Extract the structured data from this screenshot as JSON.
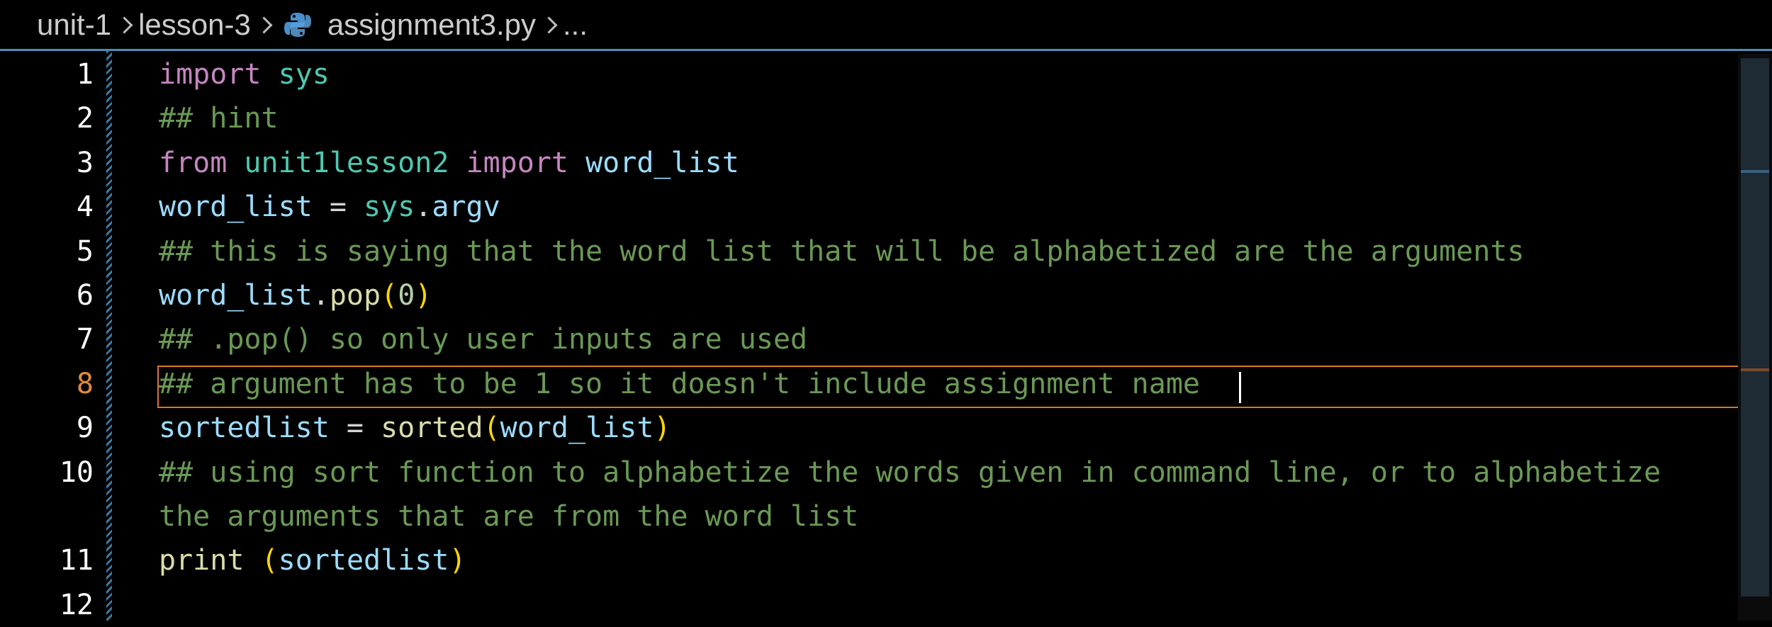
{
  "breadcrumb": {
    "items": [
      "unit-1",
      "lesson-3",
      "assignment3.py",
      "..."
    ]
  },
  "editor": {
    "active_line": 8,
    "lines": [
      {
        "n": "1",
        "tokens": [
          [
            "kw",
            "import"
          ],
          [
            "pun",
            " "
          ],
          [
            "mod",
            "sys"
          ]
        ]
      },
      {
        "n": "2",
        "tokens": [
          [
            "cm",
            "## hint"
          ]
        ]
      },
      {
        "n": "3",
        "tokens": [
          [
            "kw",
            "from"
          ],
          [
            "pun",
            " "
          ],
          [
            "mod",
            "unit1lesson2"
          ],
          [
            "pun",
            " "
          ],
          [
            "kw",
            "import"
          ],
          [
            "pun",
            " "
          ],
          [
            "var",
            "word_list"
          ]
        ]
      },
      {
        "n": "4",
        "tokens": [
          [
            "var",
            "word_list"
          ],
          [
            "pun",
            " = "
          ],
          [
            "mod",
            "sys"
          ],
          [
            "pun",
            "."
          ],
          [
            "var",
            "argv"
          ]
        ]
      },
      {
        "n": "5",
        "tokens": [
          [
            "cm",
            "## this is saying that the word list that will be alphabetized are the arguments"
          ]
        ]
      },
      {
        "n": "6",
        "tokens": [
          [
            "var",
            "word_list"
          ],
          [
            "pun",
            "."
          ],
          [
            "fn",
            "pop"
          ],
          [
            "paren",
            "("
          ],
          [
            "num",
            "0"
          ],
          [
            "paren",
            ")"
          ]
        ]
      },
      {
        "n": "7",
        "tokens": [
          [
            "cm",
            "## .pop() so only user inputs are used"
          ]
        ]
      },
      {
        "n": "8",
        "tokens": [
          [
            "cm",
            "## argument has to be 1 so it doesn't include assignment name"
          ]
        ]
      },
      {
        "n": "9",
        "tokens": [
          [
            "var",
            "sortedlist"
          ],
          [
            "pun",
            " = "
          ],
          [
            "fn",
            "sorted"
          ],
          [
            "paren",
            "("
          ],
          [
            "var",
            "word_list"
          ],
          [
            "paren",
            ")"
          ]
        ]
      },
      {
        "n": "10",
        "tokens": [
          [
            "cm",
            "## using sort function to alphabetize the words given in command line, or to alphabetize"
          ]
        ]
      },
      {
        "n": "",
        "tokens": [
          [
            "cm",
            "the arguments that are from the word list"
          ]
        ]
      },
      {
        "n": "11",
        "tokens": [
          [
            "fn",
            "print"
          ],
          [
            "pun",
            " "
          ],
          [
            "paren",
            "("
          ],
          [
            "var",
            "sortedlist"
          ],
          [
            "paren",
            ")"
          ]
        ]
      },
      {
        "n": "12",
        "tokens": []
      }
    ]
  },
  "colors": {
    "keyword": "#c586c0",
    "module": "#4ec9b0",
    "variable": "#9cdcfe",
    "function": "#dcdcaa",
    "comment": "#6a9955",
    "number": "#b5cea8",
    "current_line_border": "#d9772c"
  }
}
